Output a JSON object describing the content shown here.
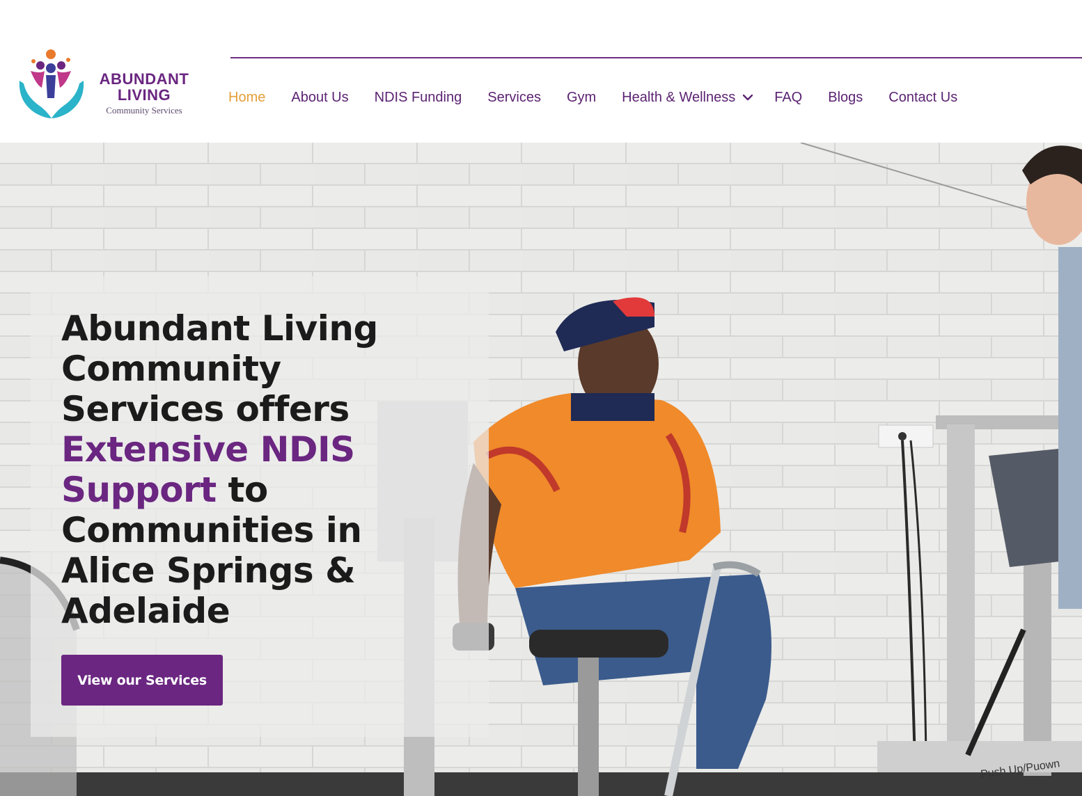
{
  "brand": {
    "line1": "ABUNDANT",
    "line2": "LIVING",
    "line3": "Community Services"
  },
  "nav": {
    "items": [
      {
        "label": "Home",
        "active": true
      },
      {
        "label": "About Us"
      },
      {
        "label": "NDIS Funding"
      },
      {
        "label": "Services"
      },
      {
        "label": "Gym"
      },
      {
        "label": "Health & Wellness",
        "dropdown": true
      },
      {
        "label": "FAQ"
      },
      {
        "label": "Blogs"
      },
      {
        "label": "Contact Us"
      }
    ]
  },
  "hero": {
    "headline_part1": "Abundant Living Community Services offers ",
    "headline_accent": "Extensive NDIS Support",
    "headline_part2": " to Communities in Alice Springs & Adelaide",
    "cta_label": "View our Services",
    "machine_label": "Push Up/Pu",
    "machine_label_cont": "own"
  },
  "colors": {
    "brand_purple": "#6a2680",
    "nav_active": "#e3a03a",
    "nav_text": "#5b2372"
  }
}
